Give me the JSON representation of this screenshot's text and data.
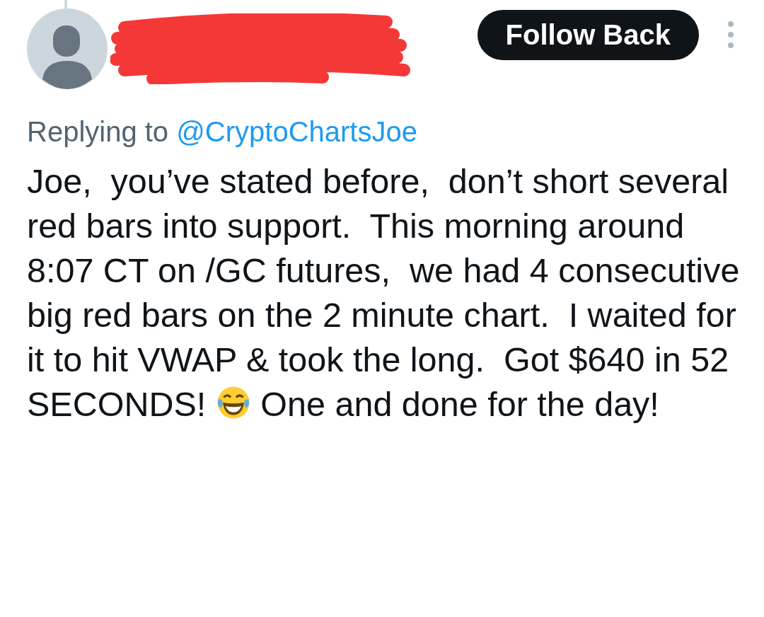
{
  "follow_button": {
    "label": "Follow Back"
  },
  "replying_to": {
    "prefix": "Replying to",
    "handle": "@CryptoChartsJoe"
  },
  "body": [
    {
      "kind": "text",
      "text": "Joe,  you’ve stated before,  don’t short several red bars into support.  This morning around 8:07 CT on /GC futures,  we had 4 consecutive big red bars on the 2 minute chart.  I waited for it to hit VWAP & took the long.  Got $640 in 52 SECONDS! "
    },
    {
      "kind": "emoji"
    },
    {
      "kind": "text",
      "text": " One and done for the day!"
    }
  ]
}
